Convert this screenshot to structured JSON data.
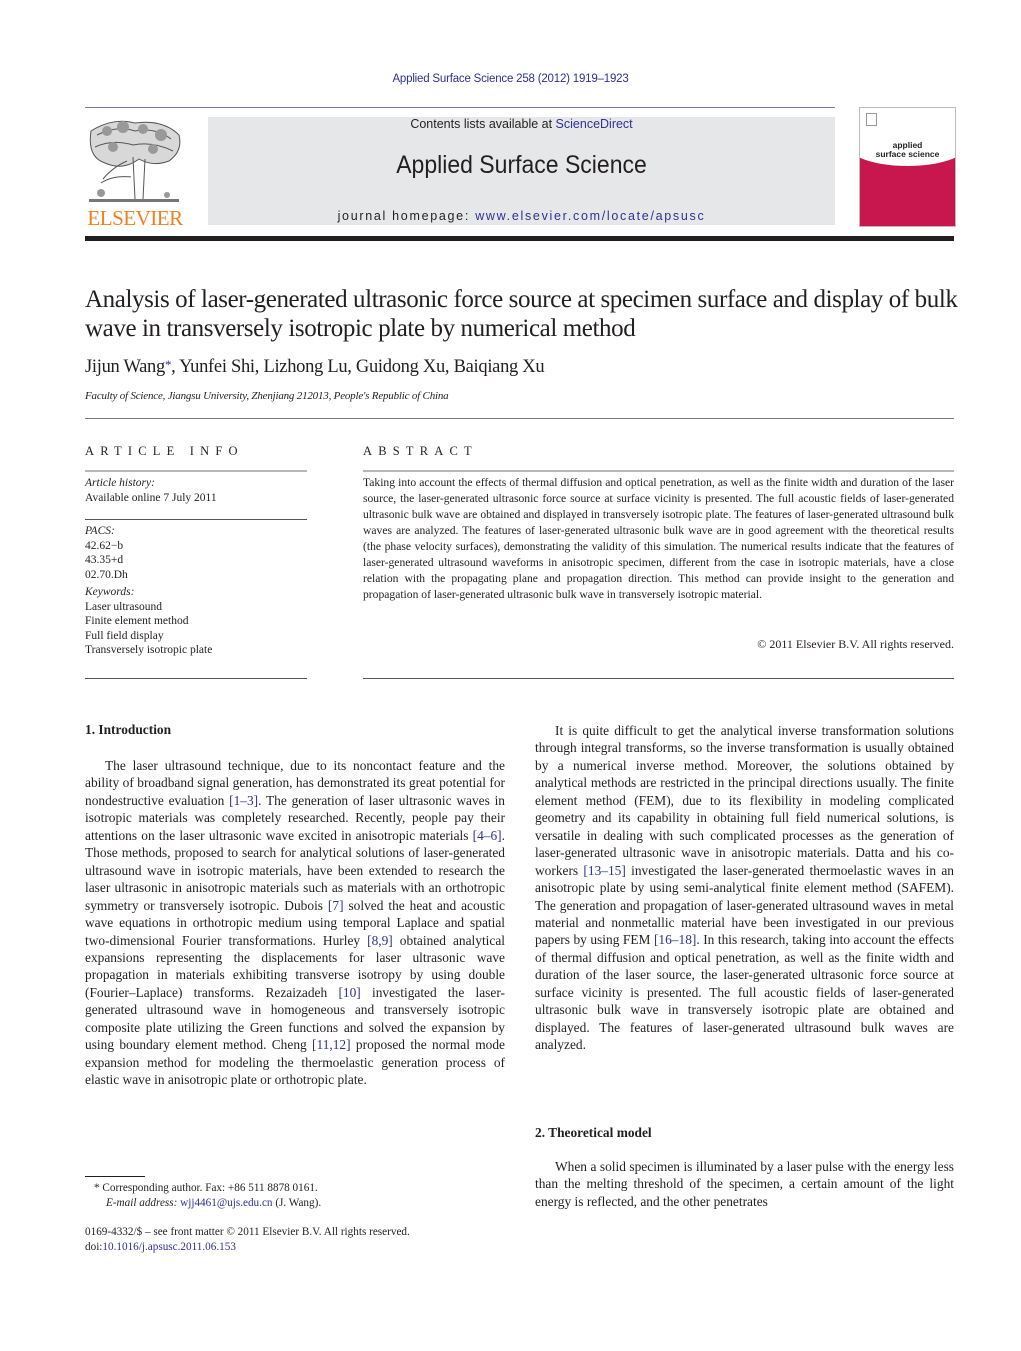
{
  "header": {
    "citation": "Applied Surface Science 258 (2012) 1919–1923",
    "contents_prefix": "Contents lists available at ",
    "contents_link": "ScienceDirect",
    "journal_name": "Applied Surface Science",
    "homepage_prefix": "journal homepage: ",
    "homepage_link": "www.elsevier.com/locate/apsusc",
    "publisher_logo_text": "ELSEVIER",
    "cover_title_line1": "applied",
    "cover_title_line2": "surface science",
    "colors": {
      "publisher_orange": "#f07f22",
      "link_blue": "#2e3192",
      "cover_red": "#c8174f",
      "masthead_grey": "#e6e7e8"
    }
  },
  "article": {
    "title": "Analysis of laser-generated ultrasonic force source at specimen surface and display of bulk wave in transversely isotropic plate by numerical method",
    "authors": [
      {
        "name": "Jijun Wang",
        "mark": "*"
      },
      {
        "name": "Yunfei Shi"
      },
      {
        "name": "Lizhong Lu"
      },
      {
        "name": "Guidong Xu"
      },
      {
        "name": "Baiqiang Xu"
      }
    ],
    "affiliation": "Faculty of Science, Jiangsu University, Zhenjiang 212013, People's Republic of China"
  },
  "article_info": {
    "heading": "ARTICLE INFO",
    "history_label": "Article history:",
    "history_value": "Available online 7 July 2011",
    "pacs_label": "PACS:",
    "pacs": [
      "42.62−b",
      "43.35+d",
      "02.70.Dh"
    ],
    "keywords_label": "Keywords:",
    "keywords": [
      "Laser ultrasound",
      "Finite element method",
      "Full field display",
      "Transversely isotropic plate"
    ]
  },
  "abstract": {
    "heading": "ABSTRACT",
    "text": "Taking into account the effects of thermal diffusion and optical penetration, as well as the finite width and duration of the laser source, the laser-generated ultrasonic force source at surface vicinity is presented. The full acoustic fields of laser-generated ultrasonic bulk wave are obtained and displayed in transversely isotropic plate. The features of laser-generated ultrasound bulk waves are analyzed. The features of laser-generated ultrasonic bulk wave are in good agreement with the theoretical results (the phase velocity surfaces), demonstrating the validity of this simulation. The numerical results indicate that the features of laser-generated ultrasound waveforms in anisotropic specimen, different from the case in isotropic materials, have a close relation with the propagating plane and propagation direction. This method can provide insight to the generation and propagation of laser-generated ultrasonic bulk wave in transversely isotropic material.",
    "copyright": "© 2011 Elsevier B.V. All rights reserved."
  },
  "intro": {
    "heading": "1.  Introduction",
    "p1": [
      "The laser ultrasound technique, due to its noncontact feature and the ability of broadband signal generation, has demonstrated its great potential for nondestructive evaluation ",
      "[1–3]",
      ". The generation of laser ultrasonic waves in isotropic materials was completely researched. Recently, people pay their attentions on the laser ultrasonic wave excited in anisotropic materials ",
      "[4–6]",
      ". Those methods, proposed to search for analytical solutions of laser-generated ultrasound wave in isotropic materials, have been extended to research the laser ultrasonic in anisotropic materials such as materials with an orthotropic symmetry or transversely isotropic. Dubois ",
      "[7]",
      " solved the heat and acoustic wave equations in orthotropic medium using temporal Laplace and spatial two-dimensional Fourier transformations. Hurley ",
      "[8,9]",
      " obtained analytical expansions representing the displacements for laser ultrasonic wave propagation in materials exhibiting transverse isotropy by using double (Fourier–Laplace) transforms. Rezaizadeh ",
      "[10]",
      " investigated the laser-generated ultrasound wave in homogeneous and transversely isotropic composite plate utilizing the Green functions and solved the expansion by using boundary element method. Cheng ",
      "[11,12]",
      " proposed the normal mode expansion method for modeling the thermoelastic generation process of elastic wave in anisotropic plate or orthotropic plate."
    ],
    "p2": [
      "It is quite difficult to get the analytical inverse transformation solutions through integral transforms, so the inverse transformation is usually obtained by a numerical inverse method. Moreover, the solutions obtained by analytical methods are restricted in the principal directions usually. The finite element method (FEM), due to its flexibility in modeling complicated geometry and its capability in obtaining full field numerical solutions, is versatile in dealing with such complicated processes as the generation of laser-generated ultrasonic wave in anisotropic materials. Datta and his co-workers ",
      "[13–15]",
      " investigated the laser-generated thermoelastic waves in an anisotropic plate by using semi-analytical finite element method (SAFEM). The generation and propagation of laser-generated ultrasound waves in metal material and nonmetallic material have been investigated in our previous papers by using FEM ",
      "[16–18]",
      ". In this research, taking into account the effects of thermal diffusion and optical penetration, as well as the finite width and duration of the laser source, the laser-generated ultrasonic force source at surface vicinity is presented. The full acoustic fields of laser-generated ultrasonic bulk wave in transversely isotropic plate are obtained and displayed. The features of laser-generated ultrasound bulk waves are analyzed."
    ]
  },
  "theory": {
    "heading": "2.  Theoretical model",
    "p1": "When a solid specimen is illuminated by a laser pulse with the energy less than the melting threshold of the specimen, a certain amount of the light energy is reflected, and the other penetrates"
  },
  "footnotes": {
    "mark": "*",
    "corresponding": "Corresponding author. Fax: +86 511 8878 0161.",
    "email_label": "E-mail address: ",
    "email": "wjj4461@ujs.edu.cn",
    "email_suffix": " (J. Wang).",
    "issn_line": "0169-4332/$ – see front matter © 2011 Elsevier B.V. All rights reserved.",
    "doi_prefix": "doi:",
    "doi": "10.1016/j.apsusc.2011.06.153"
  }
}
